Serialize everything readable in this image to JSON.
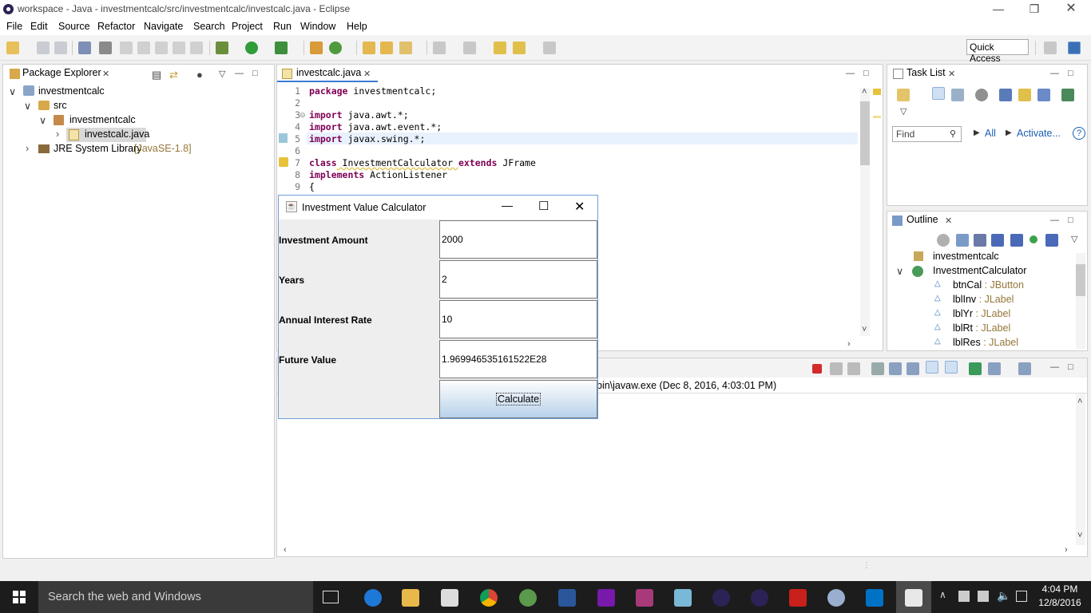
{
  "window": {
    "title": "workspace - Java - investmentcalc/src/investmentcalc/investcalc.java - Eclipse"
  },
  "menu": [
    "File",
    "Edit",
    "Source",
    "Refactor",
    "Navigate",
    "Search",
    "Project",
    "Run",
    "Window",
    "Help"
  ],
  "quick_access": "Quick Access",
  "package_explorer": {
    "tab": "Package Explorer",
    "project": "investmentcalc",
    "src": "src",
    "package": "investmentcalc",
    "file": "investcalc.java",
    "jre": "JRE System Library",
    "jre_version": "[JavaSE-1.8]"
  },
  "editor": {
    "tab": "investcalc.java",
    "line_numbers": [
      "1",
      "2",
      "3",
      "4",
      "5",
      "6",
      "7",
      "8",
      "9"
    ],
    "lines": {
      "l1a": "package",
      "l1b": " investmentcalc;",
      "l3a": "import",
      "l3b": " java.awt.*;",
      "l4a": "import",
      "l4b": " java.awt.event.*;",
      "l5a": "import",
      "l5b": " javax.swing.*;",
      "l7a": "class",
      "l7b": " InvestmentCalculator ",
      "l7c": "extends",
      "l7d": " JFrame",
      "l8a": "implements",
      "l8b": " ActionListener",
      "l9": "{"
    }
  },
  "task_list": {
    "tab": "Task List",
    "find_placeholder": "Find",
    "all": "All",
    "activate": "Activate..."
  },
  "outline": {
    "tab": "Outline",
    "root": "investmentcalc",
    "class": "InvestmentCalculator",
    "members": [
      {
        "name": "btnCal",
        "type": " : JButton"
      },
      {
        "name": "lblInv",
        "type": " : JLabel"
      },
      {
        "name": "lblYr",
        "type": " : JLabel"
      },
      {
        "name": "lblRt",
        "type": " : JLabel"
      },
      {
        "name": "lblRes",
        "type": " : JLabel"
      }
    ]
  },
  "console": {
    "text": "bin\\javaw.exe (Dec 8, 2016, 4:03:01 PM)"
  },
  "dialog": {
    "title": "Investment Value Calculator",
    "rows": [
      {
        "label": "Investment Amount",
        "value": "2000"
      },
      {
        "label": "Years",
        "value": "2"
      },
      {
        "label": "Annual Interest Rate",
        "value": "10"
      },
      {
        "label": "Future Value",
        "value": "1.969946535161522E28"
      }
    ],
    "button": "Calculate"
  },
  "taskbar": {
    "search": "Search the web and Windows",
    "time": "4:04 PM",
    "date": "12/8/2016"
  }
}
